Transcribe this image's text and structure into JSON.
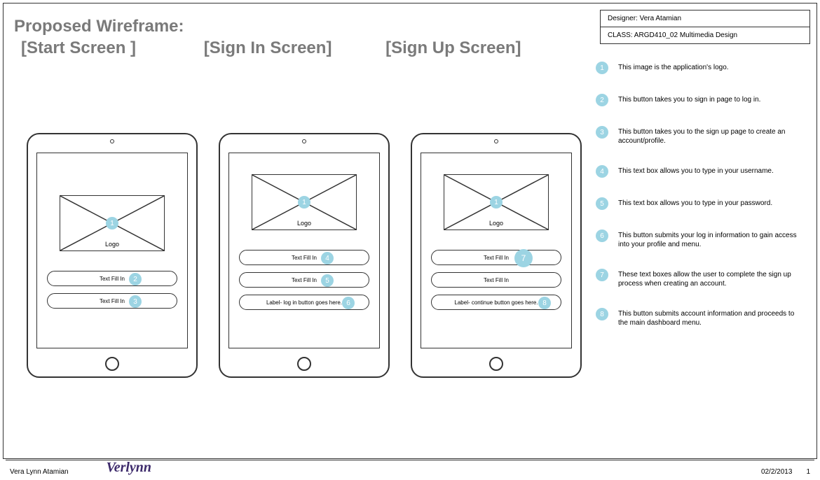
{
  "title": {
    "line1": "Proposed Wireframe:",
    "start_label": "[Start Screen ]",
    "signin_label": "[Sign In Screen]",
    "signup_label": "[Sign Up Screen]"
  },
  "info": {
    "designer_label": "Designer: Vera Atamian",
    "class_label": "CLASS: ARGD410_02 Multimedia Design"
  },
  "logo_label": "Logo",
  "pills": {
    "text_fill": "Text Fill In",
    "login_label": "Label- log in button goes here.",
    "continue_label": "Label- continue button goes here."
  },
  "badges": {
    "b1": "1",
    "b2": "2",
    "b3": "3",
    "b4": "4",
    "b5": "5",
    "b6": "6",
    "b7": "7",
    "b8": "8"
  },
  "annotations": {
    "a1": "This image is the application's logo.",
    "a2": "This button takes you to sign in page to log in.",
    "a3": "This button takes you to the sign up page to create an account/profile.",
    "a4": "This text box allows you to type in your username.",
    "a5": "This text box allows you to type in your password.",
    "a6": "This button submits your log in information to gain access into your profile and menu.",
    "a7": "These text boxes allow the user to complete the sign up process when creating an account.",
    "a8": "This button submits account information and proceeds to the main dashboard menu."
  },
  "footer": {
    "author": "Vera Lynn Atamian",
    "signature": "Verlynn",
    "date": "02/2/2013",
    "page": "1"
  }
}
